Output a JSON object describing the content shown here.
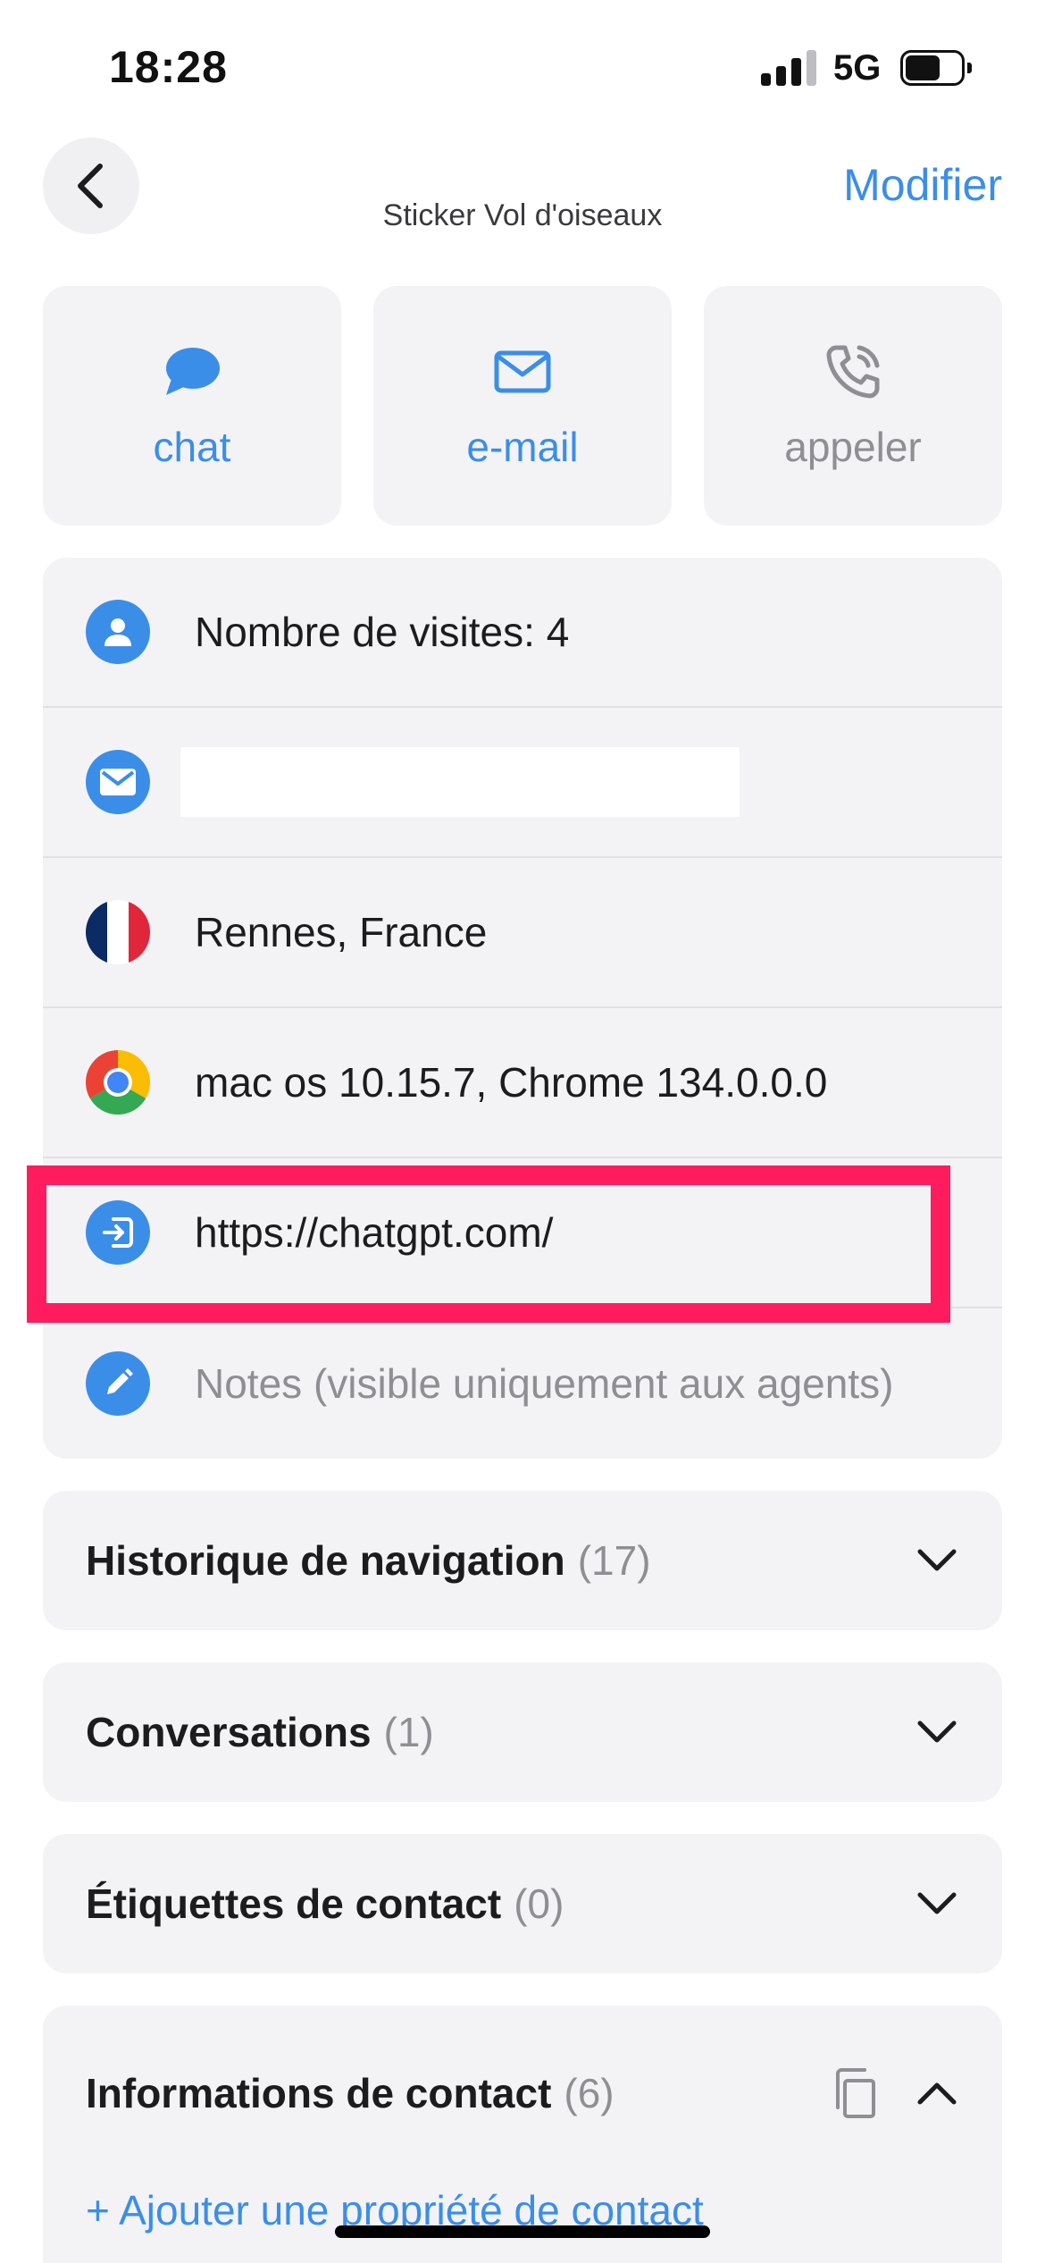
{
  "status": {
    "time": "18:28",
    "network": "5G"
  },
  "nav": {
    "title": "Sticker Vol d'oiseaux",
    "edit_label": "Modifier"
  },
  "actions": [
    {
      "label": "chat",
      "icon": "chat-bubble-icon"
    },
    {
      "label": "e-mail",
      "icon": "mail-icon"
    },
    {
      "label": "appeler",
      "icon": "phone-icon"
    }
  ],
  "info": {
    "visits": "Nombre de visites: 4",
    "email": "",
    "location": "Rennes, France",
    "browser": "mac os 10.15.7, Chrome 134.0.0.0",
    "landing_url": "https://chatgpt.com/",
    "notes_placeholder": "Notes (visible uniquement aux agents)"
  },
  "sections": [
    {
      "name": "Historique de navigation",
      "count": "(17)"
    },
    {
      "name": "Conversations",
      "count": "(1)"
    },
    {
      "name": "Étiquettes de contact",
      "count": "(0)"
    }
  ],
  "contact_info": {
    "name": "Informations de contact",
    "count": "(6)",
    "add_label": "+ Ajouter une propriété de contact"
  },
  "colors": {
    "accent": "#3b8ee8",
    "highlight": "#fe1c5e",
    "card": "#f3f3f5"
  }
}
